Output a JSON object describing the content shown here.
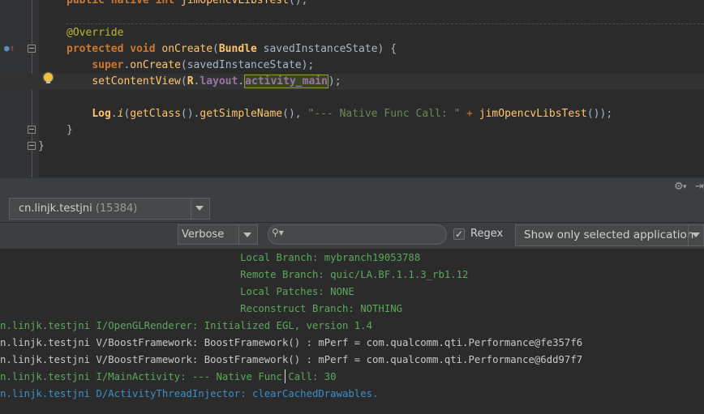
{
  "editor": {
    "lines": [
      {
        "tokens": [
          {
            "t": "public native ",
            "c": "kw"
          },
          {
            "t": "int ",
            "c": "kw"
          },
          {
            "t": "jimOpencvLibsTest",
            "c": "fn"
          },
          {
            "t": "();",
            "c": ""
          }
        ]
      },
      {
        "tokens": []
      },
      {
        "tokens": [
          {
            "t": "@Override",
            "c": "ann"
          }
        ]
      },
      {
        "tokens": [
          {
            "t": "protected void ",
            "c": "kw"
          },
          {
            "t": "onCreate",
            "c": "fn"
          },
          {
            "t": "(",
            "c": ""
          },
          {
            "t": "Bundle",
            "c": "cls"
          },
          {
            "t": " savedInstanceState) {",
            "c": ""
          }
        ]
      },
      {
        "tokens": [
          {
            "t": "    ",
            "c": ""
          },
          {
            "t": "super",
            "c": "sup"
          },
          {
            "t": ".",
            "c": ""
          },
          {
            "t": "onCreate",
            "c": "fn"
          },
          {
            "t": "(savedInstanceState);",
            "c": ""
          }
        ]
      },
      {
        "tokens": [
          {
            "t": "    ",
            "c": ""
          },
          {
            "t": "setContentView",
            "c": "fn"
          },
          {
            "t": "(",
            "c": ""
          },
          {
            "t": "R",
            "c": "cls"
          },
          {
            "t": ".",
            "c": ""
          },
          {
            "t": "layout",
            "c": "fld"
          },
          {
            "t": ".",
            "c": ""
          },
          {
            "t": "activity_main",
            "c": "fld hl"
          },
          {
            "t": ");",
            "c": ""
          }
        ],
        "current": true
      },
      {
        "tokens": []
      },
      {
        "tokens": [
          {
            "t": "    ",
            "c": ""
          },
          {
            "t": "Log",
            "c": "cls"
          },
          {
            "t": ".",
            "c": ""
          },
          {
            "t": "i",
            "c": "ital"
          },
          {
            "t": "(",
            "c": ""
          },
          {
            "t": "getClass",
            "c": "fn"
          },
          {
            "t": "().",
            "c": ""
          },
          {
            "t": "getSimpleName",
            "c": "fn"
          },
          {
            "t": "(), ",
            "c": ""
          },
          {
            "t": "\"--- Native Func Call: \"",
            "c": "str"
          },
          {
            "t": " + ",
            "c": "kw2"
          },
          {
            "t": "jimOpencvLibsTest",
            "c": "fn"
          },
          {
            "t": "());",
            "c": ""
          }
        ]
      },
      {
        "tokens": [
          {
            "t": "}",
            "c": ""
          }
        ]
      },
      {
        "tokens": [
          {
            "t": "}",
            "c": "",
            "outer": true
          }
        ]
      }
    ]
  },
  "device_bar": {
    "device_name": "cn.linjk.testjni",
    "device_pid": "(15384)"
  },
  "filter_bar": {
    "log_level": "Verbose",
    "search_value": "",
    "search_icon": "search-icon",
    "regex_label": "Regex",
    "regex_checked": "✓",
    "app_filter": "Show only selected application"
  },
  "log": {
    "lines": [
      {
        "text": "                                        Local Branch: mybranch19053788",
        "level": "i"
      },
      {
        "text": "                                        Remote Branch: quic/LA.BF.1.1.3_rb1.12",
        "level": "i"
      },
      {
        "text": "                                        Local Patches: NONE",
        "level": "i"
      },
      {
        "text": "                                        Reconstruct Branch: NOTHING",
        "level": "i"
      },
      {
        "text": "n.linjk.testjni I/OpenGLRenderer: Initialized EGL, version 1.4",
        "level": "i"
      },
      {
        "text": "n.linjk.testjni V/BoostFramework: BoostFramework() : mPerf = com.qualcomm.qti.Performance@fe357f6",
        "level": "v"
      },
      {
        "text": "n.linjk.testjni V/BoostFramework: BoostFramework() : mPerf = com.qualcomm.qti.Performance@6dd97f7",
        "level": "v"
      },
      {
        "text": "n.linjk.testjni I/MainActivity: --- Native Func Call: 30",
        "level": "i"
      },
      {
        "text": "n.linjk.testjni D/ActivityThreadInjector: clearCachedDrawables.",
        "level": "d"
      }
    ]
  },
  "colors": {
    "info": "#5ca85c",
    "verbose": "#c8c8c8",
    "debug": "#3c8fc7",
    "editor_bg": "#2b2b2b",
    "panel_bg": "#3c3f41"
  }
}
